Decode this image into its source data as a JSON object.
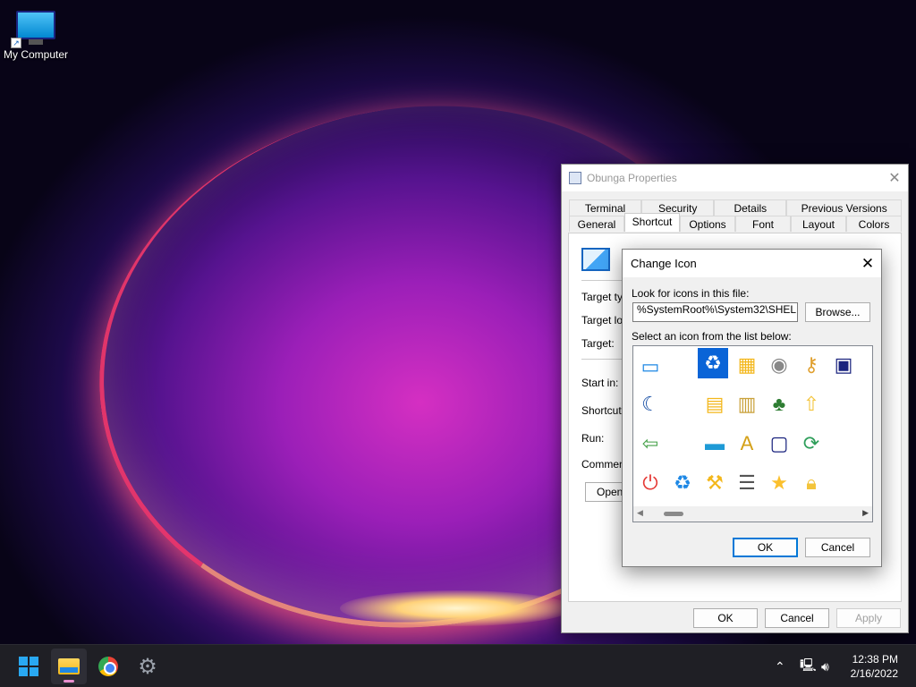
{
  "desktop": {
    "icons": [
      {
        "label": "My Computer"
      }
    ]
  },
  "properties_window": {
    "title": "Obunga Properties",
    "tabs_top": [
      "Terminal",
      "Security",
      "Details",
      "Previous Versions"
    ],
    "tabs_bottom": [
      "General",
      "Shortcut",
      "Options",
      "Font",
      "Layout",
      "Colors"
    ],
    "active_tab": "Shortcut",
    "fields": [
      "Target typ",
      "Target loc",
      "Target:",
      "Start in:",
      "Shortcut k",
      "Run:",
      "Comment:"
    ],
    "open_label": "Open",
    "ok_label": "OK",
    "cancel_label": "Cancel",
    "apply_label": "Apply"
  },
  "change_icon_dialog": {
    "title": "Change Icon",
    "look_label": "Look for icons in this file:",
    "path_value": "%SystemRoot%\\System32\\SHELL32",
    "browse_label": "Browse...",
    "select_label": "Select an icon from the list below:",
    "ok_label": "OK",
    "cancel_label": "Cancel",
    "icons": [
      "monitor-shortcut-icon",
      "recycle-bin-full-icon",
      "folder-grid-icon",
      "cd-audio-icon",
      "key-icon",
      "windows-components-icon",
      "monitor-sleep-shortcut-icon",
      "folder-search-icon",
      "drive-folder-icon",
      "tree-icon",
      "folder-upload-icon",
      "network-printer-icon",
      "taskbar-icon",
      "folder-fonts-icon",
      "folder-computer-icon",
      "network-sync-icon",
      "power-icon",
      "recycle-bin-empty-icon",
      "folder-tools-icon",
      "list-details-icon",
      "star-icon",
      "lock-icon"
    ],
    "selected_icon": "recycle-bin-full-icon"
  },
  "taskbar": {
    "apps": [
      "start-button",
      "file-explorer",
      "chrome",
      "settings"
    ],
    "time": "12:38 PM",
    "date": "2/16/2022"
  },
  "colors": {
    "accent": "#0078d7",
    "taskbar": "#1f1f25",
    "selection": "#0a64d7"
  }
}
